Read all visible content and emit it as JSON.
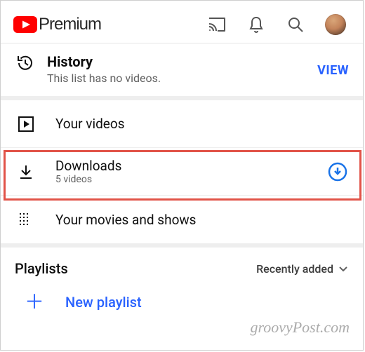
{
  "header": {
    "brand": "Premium"
  },
  "history": {
    "title": "History",
    "subtitle": "This list has no videos.",
    "view": "VIEW"
  },
  "rows": {
    "your_videos": "Your videos",
    "downloads": "Downloads",
    "downloads_sub": "5 videos",
    "movies": "Your movies and shows"
  },
  "playlists": {
    "heading": "Playlists",
    "sort": "Recently added",
    "new": "New playlist"
  },
  "watermark": "groovyPost.com"
}
